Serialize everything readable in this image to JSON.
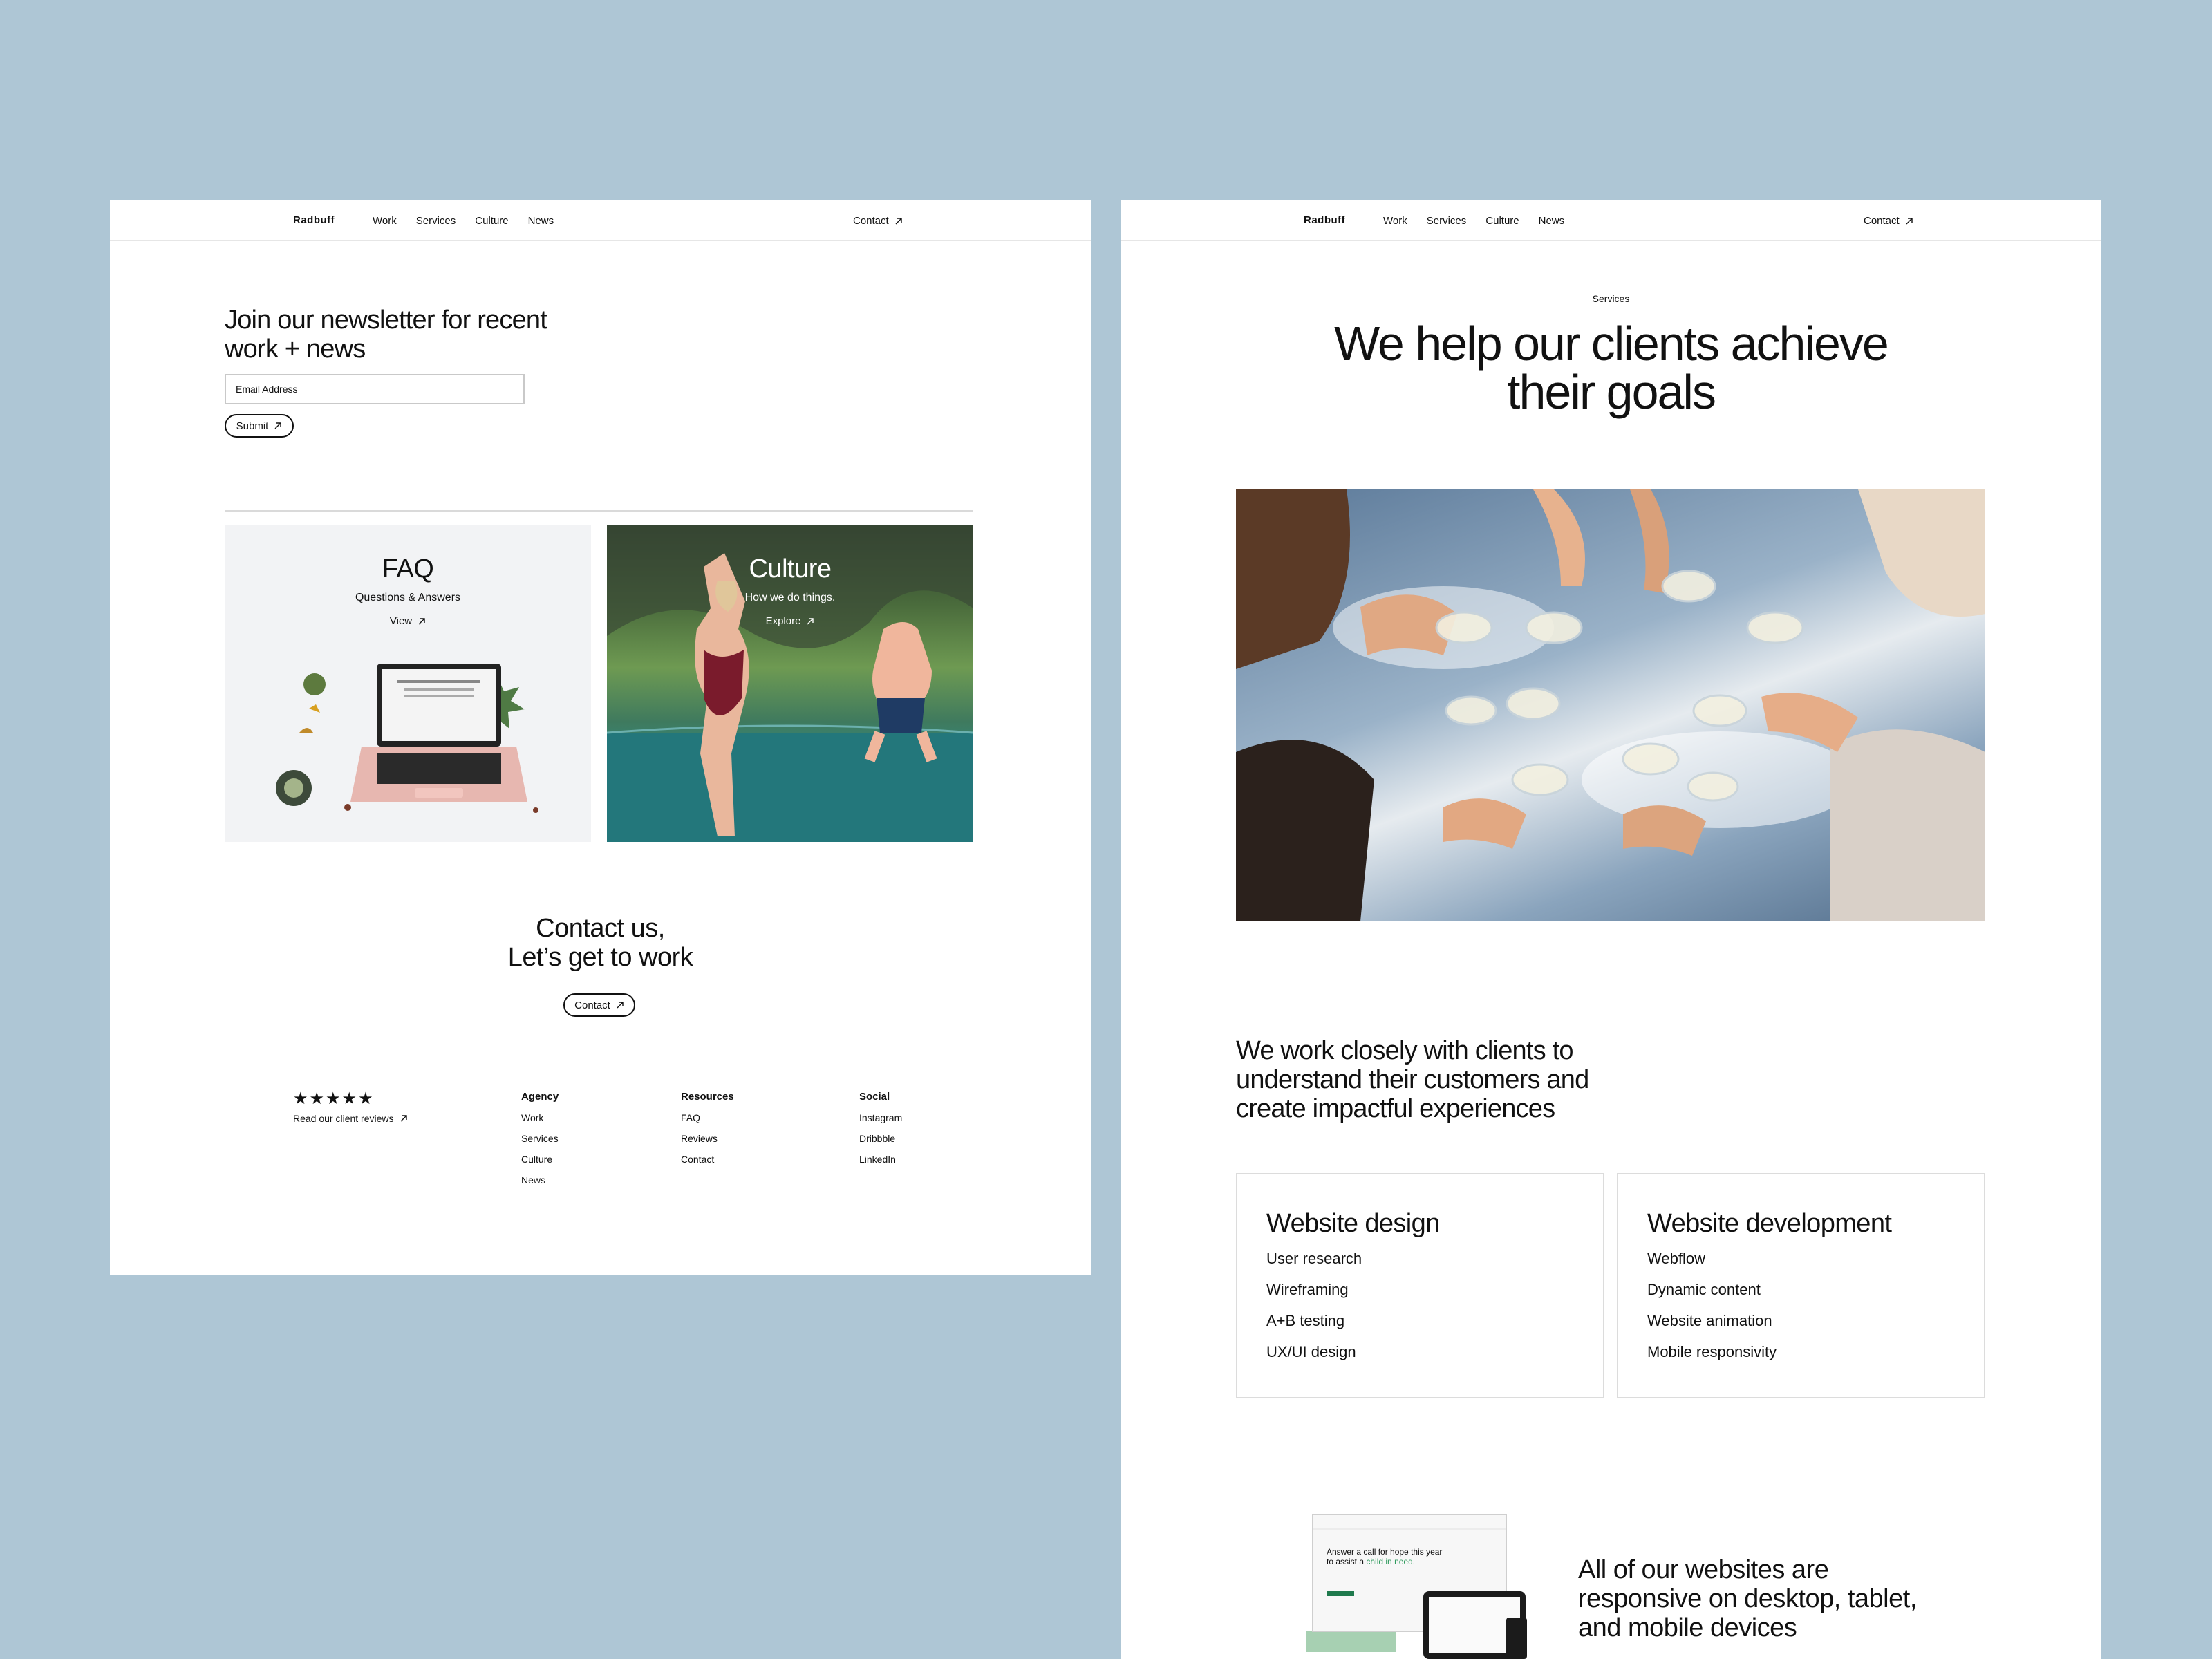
{
  "colors": {
    "background": "#aec6d5",
    "page": "#ffffff",
    "text": "#111111",
    "green_accent": "#2e9a5c"
  },
  "left_page": {
    "nav": {
      "logo": "Radbuff",
      "links": [
        "Work",
        "Services",
        "Culture",
        "News"
      ],
      "contact": "Contact",
      "contact_icon": "arrow-up-right-icon"
    },
    "newsletter": {
      "title": "Join our newsletter for recent work + news",
      "email_placeholder": "Email Address",
      "submit_label": "Submit"
    },
    "cards": {
      "faq": {
        "title": "FAQ",
        "subtitle": "Questions & Answers",
        "link": "View"
      },
      "culture": {
        "title": "Culture",
        "subtitle": "How we do things.",
        "link": "Explore"
      }
    },
    "contact": {
      "title_line1": "Contact us,",
      "title_line2": "Let’s get to work",
      "button": "Contact"
    },
    "footer": {
      "stars": "★★★★★",
      "rating": 5,
      "reviews_link": "Read our client reviews",
      "agency": {
        "heading": "Agency",
        "items": [
          "Work",
          "Services",
          "Culture",
          "News"
        ]
      },
      "resources": {
        "heading": "Resources",
        "items": [
          "FAQ",
          "Reviews",
          "Contact"
        ]
      },
      "social": {
        "heading": "Social",
        "items": [
          "Instagram",
          "Dribbble",
          "LinkedIn"
        ]
      }
    }
  },
  "right_page": {
    "nav": {
      "logo": "Radbuff",
      "links": [
        "Work",
        "Services",
        "Culture",
        "News"
      ],
      "contact": "Contact"
    },
    "eyebrow": "Services",
    "hero_line1": "We help our clients achieve",
    "hero_line2": "their goals",
    "lead": "We work closely with clients to understand their customers and create impactful experiences",
    "services": [
      {
        "title": "Website design",
        "items": [
          "User research",
          "Wireframing",
          "A+B testing",
          "UX/UI design"
        ]
      },
      {
        "title": "Website development",
        "items": [
          "Webflow",
          "Dynamic content",
          "Website animation",
          "Mobile responsivity"
        ]
      }
    ],
    "responsive_text": "All of our websites are responsive on desktop, tablet, and mobile devices",
    "device_mock": {
      "headline": "Answer a call for hope this year to assist a",
      "highlight": "child in need."
    }
  }
}
